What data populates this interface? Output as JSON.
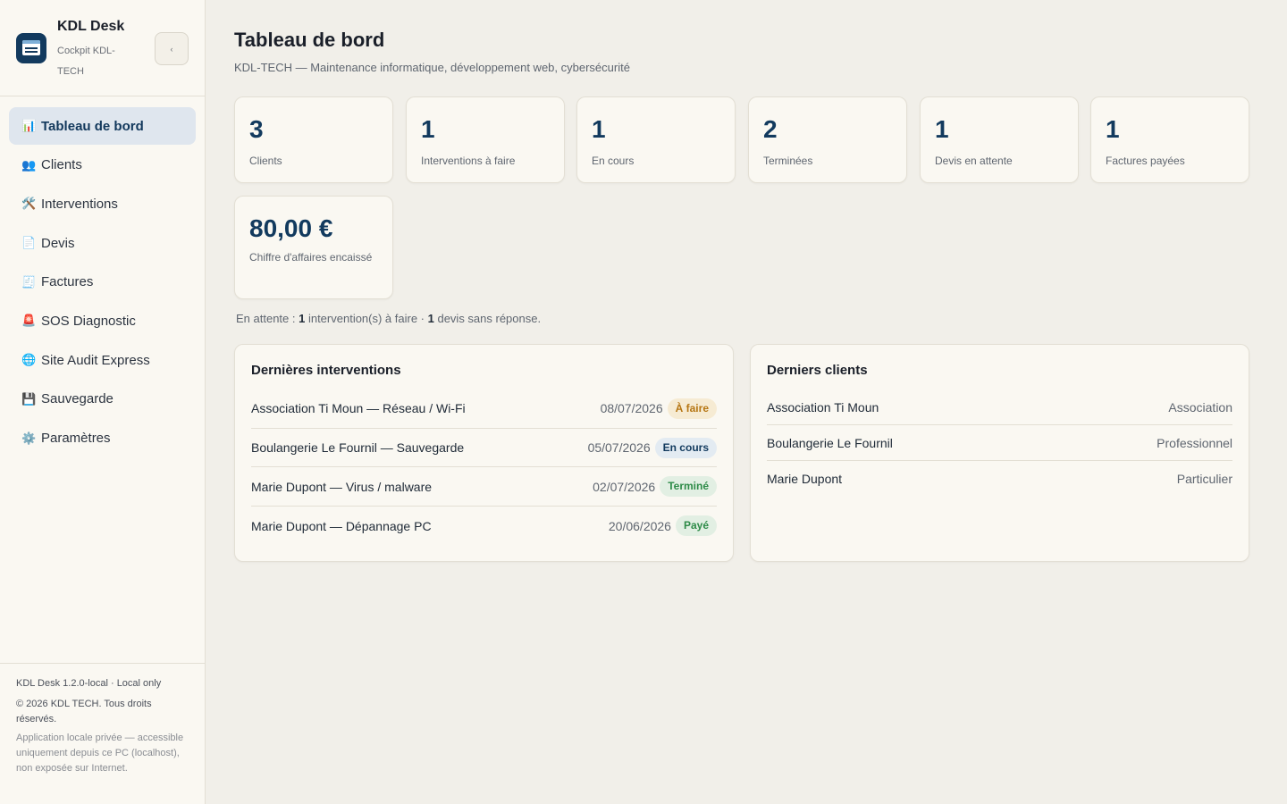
{
  "sidebar": {
    "app_name": "KDL Desk",
    "app_sub": "Cockpit KDL-TECH",
    "collapse_glyph": "‹",
    "items": [
      {
        "icon": "📊",
        "label": "Tableau de bord",
        "active": true
      },
      {
        "icon": "👥",
        "label": "Clients"
      },
      {
        "icon": "🛠️",
        "label": "Interventions"
      },
      {
        "icon": "📄",
        "label": "Devis"
      },
      {
        "icon": "🧾",
        "label": "Factures"
      },
      {
        "icon": "🚨",
        "label": "SOS Diagnostic"
      },
      {
        "icon": "🌐",
        "label": "Site Audit Express"
      },
      {
        "icon": "💾",
        "label": "Sauvegarde"
      },
      {
        "icon": "⚙️",
        "label": "Paramètres"
      }
    ],
    "footer": {
      "version": "KDL Desk 1.2.0-local · Local only",
      "copyright": "© 2026 KDL TECH. Tous droits réservés.",
      "note": "Application locale privée — accessible uniquement depuis ce PC (localhost), non exposée sur Internet."
    }
  },
  "header": {
    "title": "Tableau de bord",
    "subtitle": "KDL-TECH — Maintenance informatique, développement web, cybersécurité"
  },
  "stats": [
    {
      "value": "3",
      "label": "Clients"
    },
    {
      "value": "1",
      "label": "Interventions à faire"
    },
    {
      "value": "1",
      "label": "En cours"
    },
    {
      "value": "2",
      "label": "Terminées"
    },
    {
      "value": "1",
      "label": "Devis en attente"
    },
    {
      "value": "1",
      "label": "Factures payées"
    },
    {
      "value": "80,00 €",
      "label": "Chiffre d'affaires encaissé"
    }
  ],
  "pending": {
    "prefix": "En attente : ",
    "count1": "1",
    "text1": " intervention(s) à faire · ",
    "count2": "1",
    "text2": " devis sans réponse."
  },
  "interventions": {
    "title": "Dernières interventions",
    "rows": [
      {
        "title": "Association Ti Moun — Réseau / Wi-Fi",
        "date": "08/07/2026",
        "status": "À faire",
        "kind": "todo"
      },
      {
        "title": "Boulangerie Le Fournil — Sauvegarde",
        "date": "05/07/2026",
        "status": "En cours",
        "kind": "progress"
      },
      {
        "title": "Marie Dupont — Virus / malware",
        "date": "02/07/2026",
        "status": "Terminé",
        "kind": "done"
      },
      {
        "title": "Marie Dupont — Dépannage PC",
        "date": "20/06/2026",
        "status": "Payé",
        "kind": "paid"
      }
    ]
  },
  "clients": {
    "title": "Derniers clients",
    "rows": [
      {
        "name": "Association Ti Moun",
        "type": "Association"
      },
      {
        "name": "Boulangerie Le Fournil",
        "type": "Professionnel"
      },
      {
        "name": "Marie Dupont",
        "type": "Particulier"
      }
    ]
  }
}
